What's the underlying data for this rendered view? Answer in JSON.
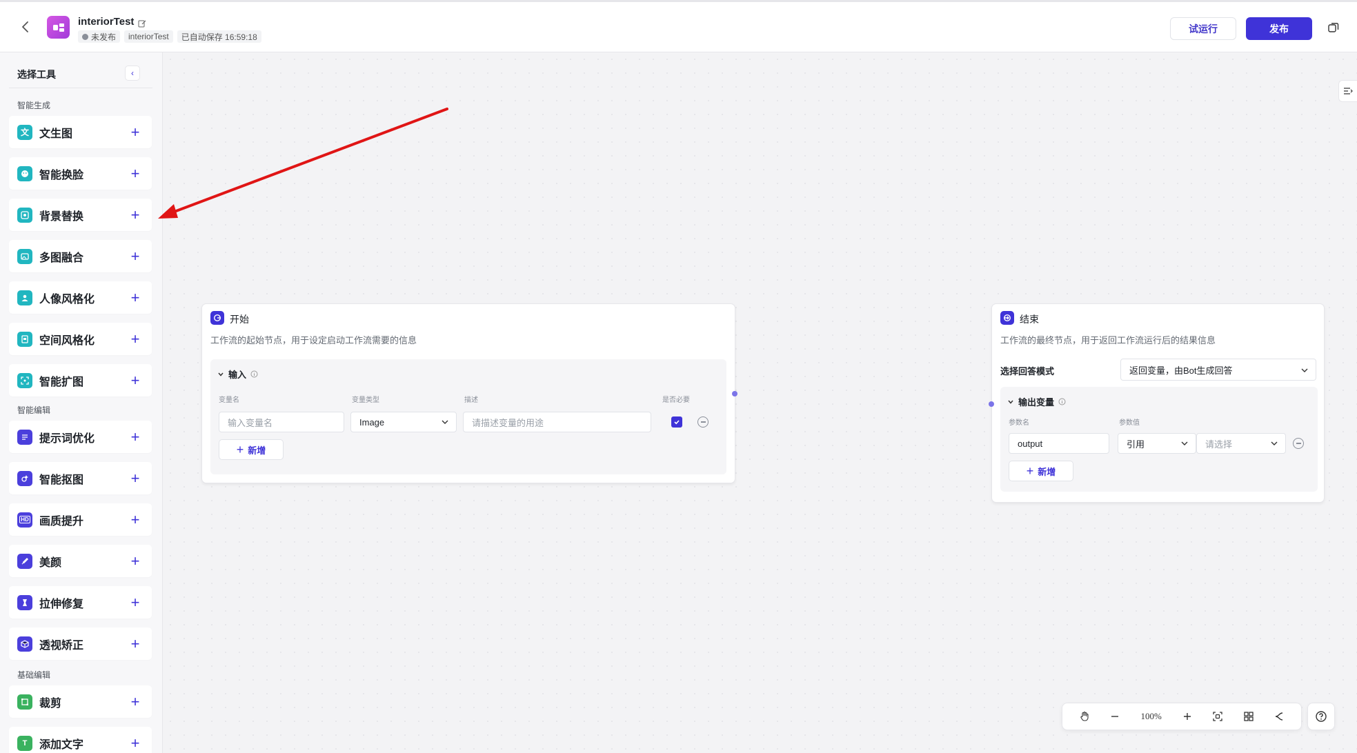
{
  "header": {
    "title": "interiorTest",
    "status": "未发布",
    "tag_name": "interiorTest",
    "autosave": "已自动保存 16:59:18",
    "trial_label": "试运行",
    "publish_label": "发布"
  },
  "sidebar": {
    "title": "选择工具",
    "sections": {
      "smart_gen": "智能生成",
      "smart_edit": "智能编辑",
      "basic_edit": "基础编辑"
    },
    "tools": [
      {
        "label": "文生图"
      },
      {
        "label": "智能换脸"
      },
      {
        "label": "背景替换"
      },
      {
        "label": "多图融合"
      },
      {
        "label": "人像风格化"
      },
      {
        "label": "空间风格化"
      },
      {
        "label": "智能扩图"
      },
      {
        "label": "提示词优化"
      },
      {
        "label": "智能抠图"
      },
      {
        "label": "画质提升"
      },
      {
        "label": "美颜"
      },
      {
        "label": "拉伸修复"
      },
      {
        "label": "透视矫正"
      },
      {
        "label": "裁剪"
      },
      {
        "label": "添加文字"
      }
    ]
  },
  "start_node": {
    "title": "开始",
    "desc": "工作流的起始节点，用于设定启动工作流需要的信息",
    "section": "输入",
    "col_name": "变量名",
    "col_type": "变量类型",
    "col_desc": "描述",
    "col_required": "是否必要",
    "name_placeholder": "输入变量名",
    "type_value": "Image",
    "desc_placeholder": "请描述变量的用途",
    "required": true,
    "add_label": "新增"
  },
  "end_node": {
    "title": "结束",
    "desc": "工作流的最终节点，用于返回工作流运行后的结果信息",
    "mode_label": "选择回答模式",
    "mode_value": "返回变量，由Bot生成回答",
    "section": "输出变量",
    "col_param": "参数名",
    "col_value": "参数值",
    "param_name": "output",
    "ref_value": "引用",
    "select_placeholder": "请选择",
    "add_label": "新增"
  },
  "zoom": {
    "level": "100%"
  },
  "colors": {
    "accent": "#3f33d8",
    "tool_teal": "#21b6c0",
    "tool_indigo": "#4b3fdc",
    "tool_green": "#3ab25f",
    "annotation_arrow": "#e01515"
  }
}
